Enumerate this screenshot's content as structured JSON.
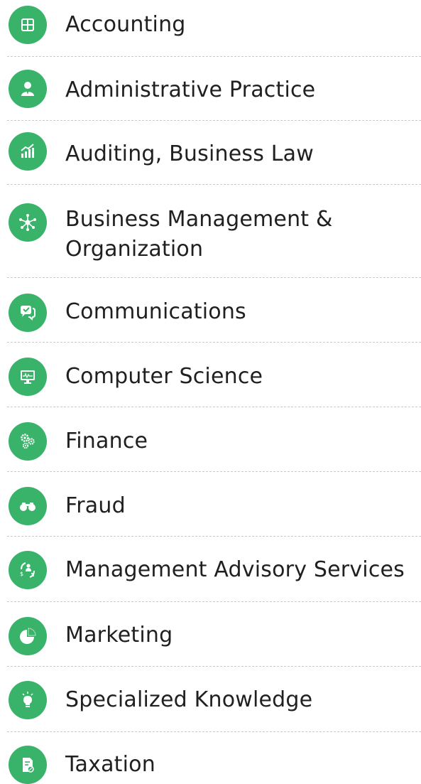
{
  "accent_color": "#3ab36a",
  "categories": [
    {
      "label": "Accounting",
      "icon": "grid-icon"
    },
    {
      "label": "Administrative Practice",
      "icon": "person-icon"
    },
    {
      "label": "Auditing, Business Law",
      "icon": "growth-chart-icon"
    },
    {
      "label": "Business Management & Organization",
      "icon": "network-icon"
    },
    {
      "label": "Communications",
      "icon": "chat-bubbles-icon"
    },
    {
      "label": "Computer Science",
      "icon": "monitor-icon"
    },
    {
      "label": "Finance",
      "icon": "gears-icon"
    },
    {
      "label": "Fraud",
      "icon": "binoculars-icon"
    },
    {
      "label": "Management Advisory Services",
      "icon": "people-cycle-icon"
    },
    {
      "label": "Marketing",
      "icon": "pie-chart-icon"
    },
    {
      "label": "Specialized Knowledge",
      "icon": "lightbulb-icon"
    },
    {
      "label": "Taxation",
      "icon": "tax-document-icon"
    }
  ]
}
